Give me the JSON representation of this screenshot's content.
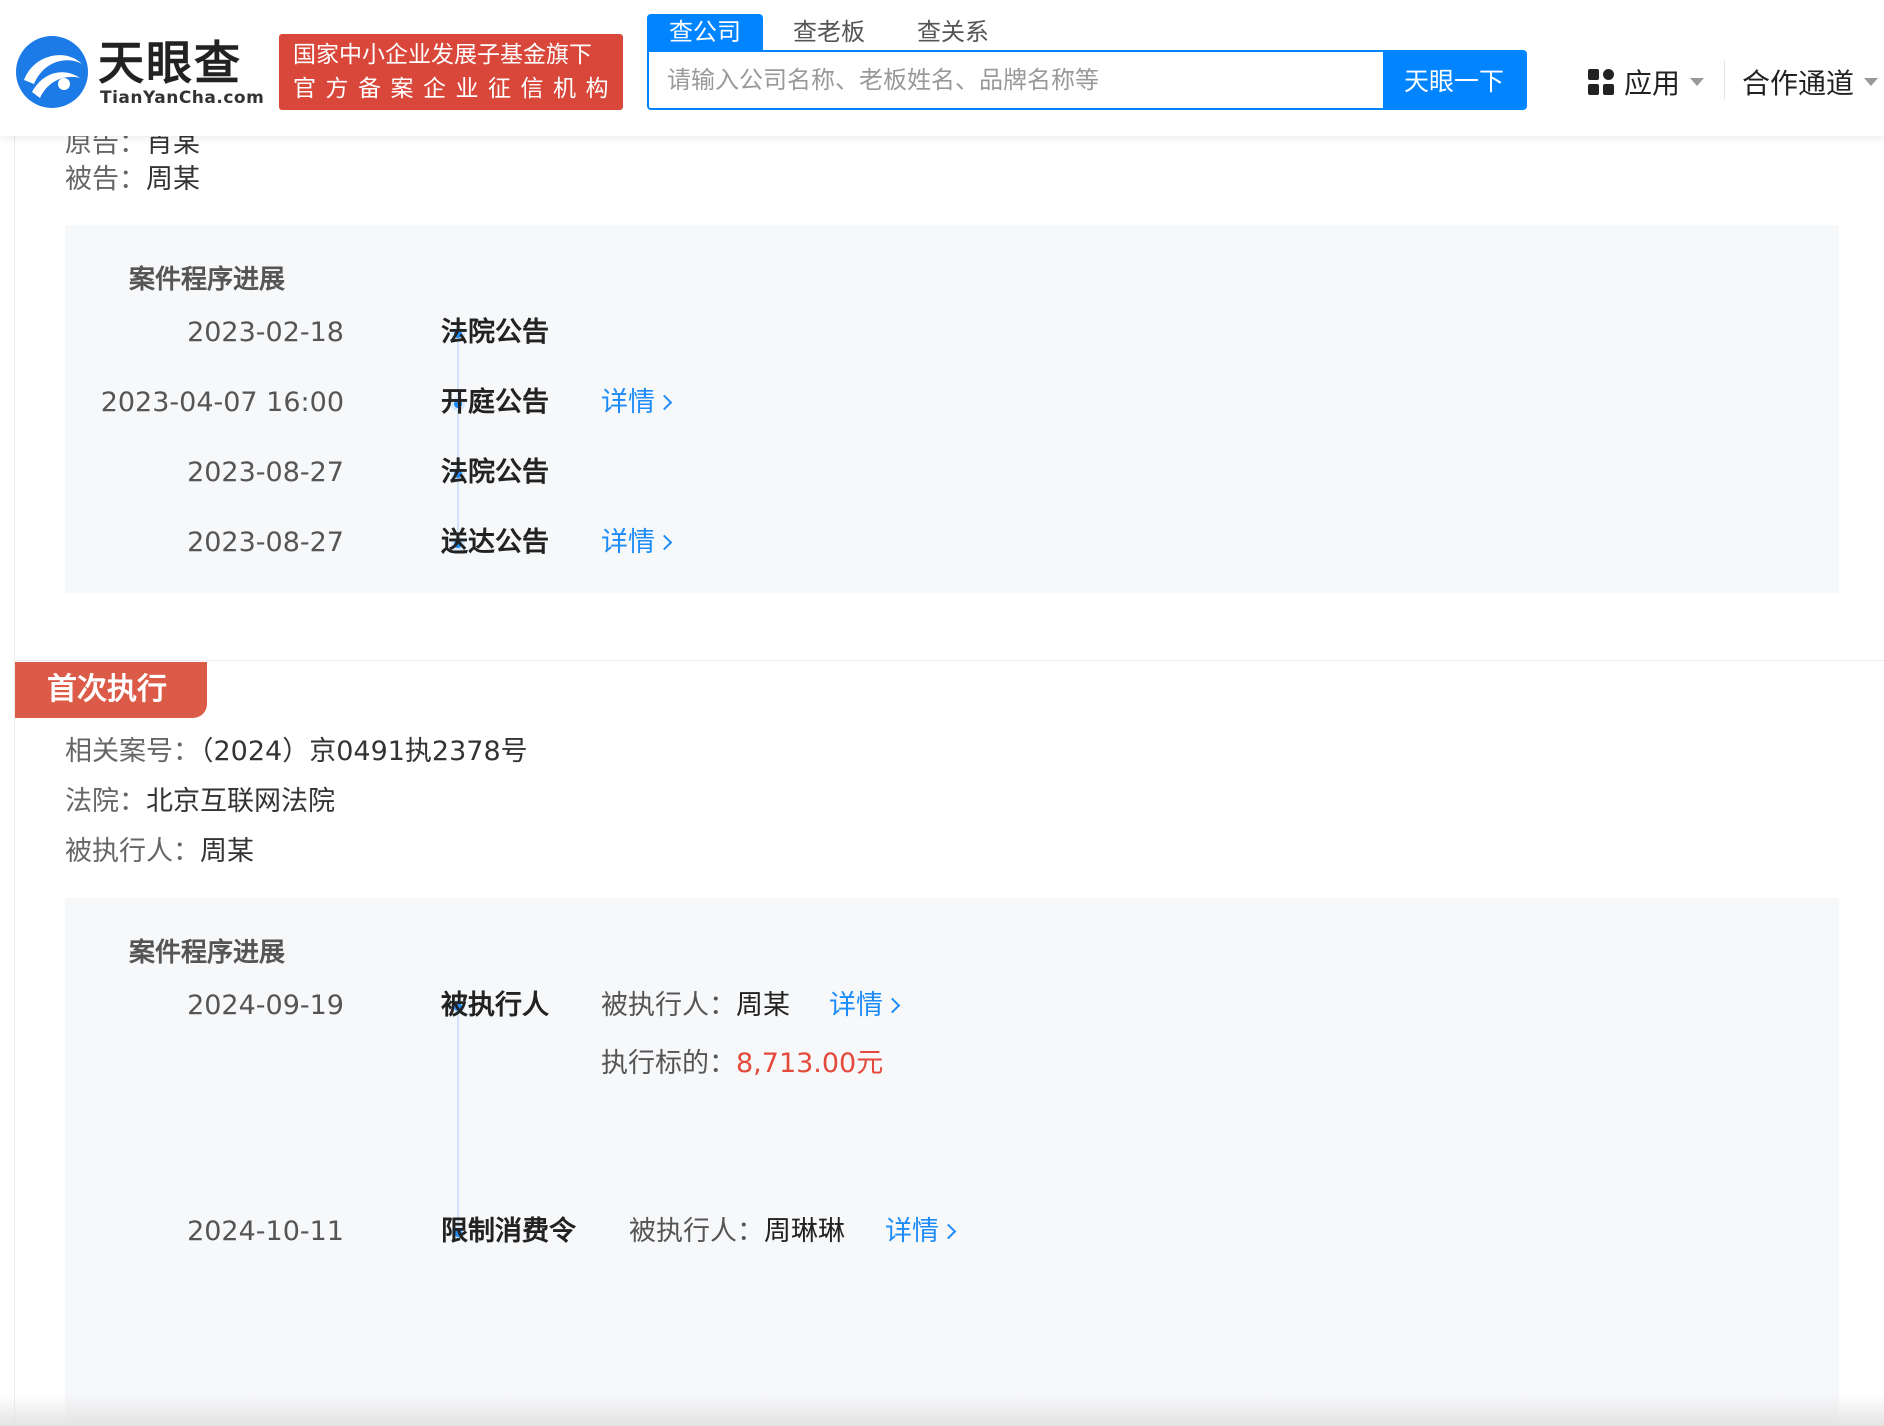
{
  "header": {
    "logo_cn": "天眼查",
    "logo_en": "TianYanCha.com",
    "badge_line1": "国家中小企业发展子基金旗下",
    "badge_line2": "官方备案企业征信机构",
    "search_tabs": [
      "查公司",
      "查老板",
      "查关系"
    ],
    "search_placeholder": "请输入公司名称、老板姓名、品牌名称等",
    "search_button": "天眼一下",
    "nav_apps": "应用",
    "nav_coop": "合作通道"
  },
  "case1": {
    "plaintiff_label": "原告：",
    "plaintiff": "肖某",
    "defendant_label": "被告：",
    "defendant": "周某",
    "progress_title": "案件程序进展",
    "events": [
      {
        "date": "2023-02-18",
        "type": "法院公告"
      },
      {
        "date": "2023-04-07 16:00",
        "type": "开庭公告",
        "link": "详情"
      },
      {
        "date": "2023-08-27",
        "type": "法院公告"
      },
      {
        "date": "2023-08-27",
        "type": "送达公告",
        "link": "详情"
      }
    ]
  },
  "case2": {
    "section_tag": "首次执行",
    "case_no_label": "相关案号：",
    "case_no": "（2024）京0491执2378号",
    "court_label": "法院：",
    "court": "北京互联网法院",
    "executee_label": "被执行人：",
    "executee": "周某",
    "progress_title": "案件程序进展",
    "events": [
      {
        "date": "2024-09-19",
        "type": "被执行人",
        "detail_label": "被执行人：",
        "detail_value": "周某",
        "link": "详情",
        "amount_label": "执行标的：",
        "amount": "8,713.00元"
      },
      {
        "date": "2024-10-11",
        "type": "限制消费令",
        "detail_label": "被执行人：",
        "detail_value": "周琳琳",
        "link": "详情"
      }
    ]
  },
  "colors": {
    "brand_blue": "#0084ff",
    "badge_red": "#d9473a",
    "tag_red": "#dc5b48",
    "amount_red": "#e34a3c",
    "link_blue": "#1d8cf8"
  }
}
